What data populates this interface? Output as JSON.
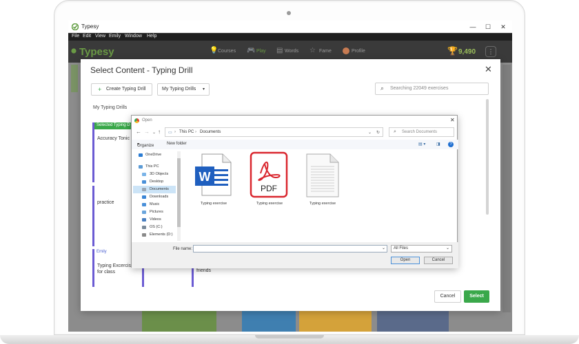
{
  "window": {
    "title": "Typesy",
    "menu": [
      "File",
      "Edit",
      "View",
      "Emily",
      "Window",
      "Help"
    ],
    "minimize_icon": "minimize-icon",
    "maximize_icon": "maximize-icon",
    "close_icon": "close-icon"
  },
  "app": {
    "brand": "Typesy",
    "nav": [
      {
        "label": "Courses",
        "icon": "lightbulb-icon"
      },
      {
        "label": "Play",
        "icon": "gamepad-icon"
      },
      {
        "label": "Words",
        "icon": "book-icon"
      },
      {
        "label": "Fame",
        "icon": "star-icon"
      },
      {
        "label": "Profile",
        "icon": "avatar-icon"
      }
    ],
    "score": "9,490",
    "more": "⋮"
  },
  "dialog": {
    "title": "Select Content - Typing Drill",
    "create_button": "Create Typing Drill",
    "my_drills_dropdown": "My Typing Drills",
    "search_placeholder": "Searching 22049 exercises",
    "section_label": "My Typing Drills",
    "cards": [
      {
        "tag": "Selected Typing D",
        "text": "Accuracy Tonic (1)"
      },
      {
        "tag": "",
        "text": "practice"
      },
      {
        "tag": "Emily",
        "text": "Typing Excercise for class"
      }
    ],
    "partial_card_text": "friends",
    "cancel_button": "Cancel",
    "select_button": "Select"
  },
  "open_dialog": {
    "title": "Open",
    "path": [
      "This PC",
      "Documents"
    ],
    "search_placeholder": "Search Documents",
    "organize": "Organize",
    "new_folder": "New folder",
    "sidebar": [
      {
        "label": "OneDrive",
        "color": "#2b7cd3"
      },
      {
        "label": "This PC",
        "color": "#5b9bd5"
      },
      {
        "label": "3D Objects",
        "color": "#7bb4e8"
      },
      {
        "label": "Desktop",
        "color": "#4a90d9"
      },
      {
        "label": "Documents",
        "color": "#9aa6b4",
        "selected": true
      },
      {
        "label": "Downloads",
        "color": "#3a86d6"
      },
      {
        "label": "Music",
        "color": "#4a90d9"
      },
      {
        "label": "Pictures",
        "color": "#6aa5dc"
      },
      {
        "label": "Videos",
        "color": "#4a7fc0"
      },
      {
        "label": "OS (C:)",
        "color": "#7a8a9a"
      },
      {
        "label": "Elements (D:)",
        "color": "#8a8a8a"
      }
    ],
    "files": [
      {
        "caption": "Typing exercise",
        "type": "word",
        "badge": "W"
      },
      {
        "caption": "Typing exercise",
        "type": "pdf",
        "badge": "PDF"
      },
      {
        "caption": "Typing exercise",
        "type": "text"
      }
    ],
    "file_name_label": "File name:",
    "file_name_value": "",
    "filter": "All Files",
    "open_button": "Open",
    "cancel_button": "Cancel"
  },
  "colors": {
    "accent_green": "#3aa84a",
    "brand_green": "#6a9a45",
    "card_border": "#6b5bd3",
    "pdf_red": "#d9262e",
    "word_blue": "#1f5fbf"
  }
}
